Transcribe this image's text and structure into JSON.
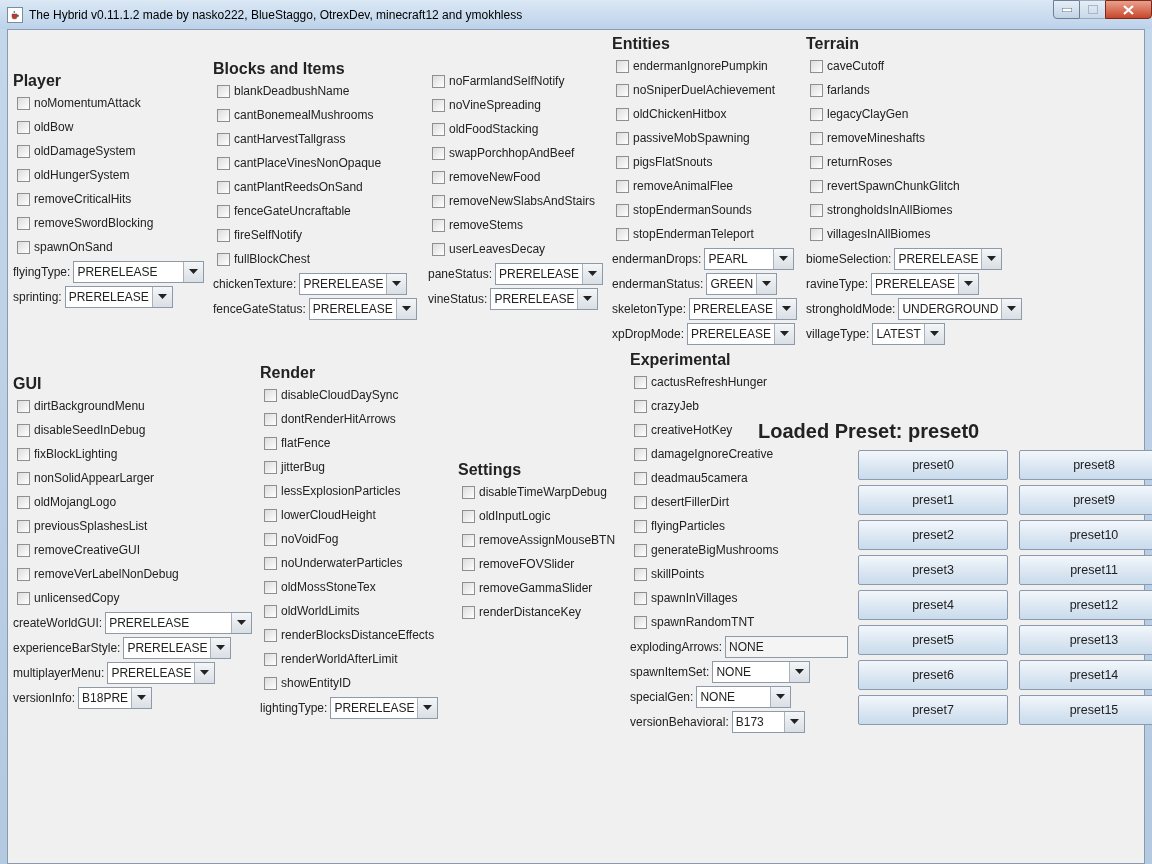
{
  "window": {
    "title": "The Hybrid v0.11.1.2 made by nasko222, BlueStaggo, OtrexDev, minecraft12 and ymokhless"
  },
  "sections": [
    {
      "title": "Player",
      "options": [
        {
          "label": "noMomentumAttack",
          "checked": false
        },
        {
          "label": "oldBow",
          "checked": false
        },
        {
          "label": "oldDamageSystem",
          "checked": false
        },
        {
          "label": "oldHungerSystem",
          "checked": false
        },
        {
          "label": "removeCriticalHits",
          "checked": false
        },
        {
          "label": "removeSwordBlocking",
          "checked": false
        },
        {
          "label": "spawnOnSand",
          "checked": false
        }
      ],
      "settings": [
        {
          "label": "flyingType:",
          "value": "PRERELEASE",
          "kind": "combo"
        },
        {
          "label": "sprinting:",
          "value": "PRERELEASE",
          "kind": "combo"
        }
      ]
    },
    {
      "title": "Blocks and Items",
      "options": [
        {
          "label": "blankDeadbushName",
          "checked": false
        },
        {
          "label": "cantBonemealMushrooms",
          "checked": false
        },
        {
          "label": "cantHarvestTallgrass",
          "checked": false
        },
        {
          "label": "cantPlaceVinesNonOpaque",
          "checked": false
        },
        {
          "label": "cantPlantReedsOnSand",
          "checked": false
        },
        {
          "label": "fenceGateUncraftable",
          "checked": false
        },
        {
          "label": "fireSelfNotify",
          "checked": false
        },
        {
          "label": "fullBlockChest",
          "checked": false
        }
      ],
      "settings": [
        {
          "label": "chickenTexture:",
          "value": "PRERELEASE",
          "kind": "combo"
        },
        {
          "label": "fenceGateStatus:",
          "value": "PRERELEASE",
          "kind": "combo"
        }
      ]
    },
    {
      "options": [
        {
          "label": "noFarmlandSelfNotify",
          "checked": false
        },
        {
          "label": "noVineSpreading",
          "checked": false
        },
        {
          "label": "oldFoodStacking",
          "checked": false
        },
        {
          "label": "swapPorchhopAndBeef",
          "checked": false
        },
        {
          "label": "removeNewFood",
          "checked": false
        },
        {
          "label": "removeNewSlabsAndStairs",
          "checked": false
        },
        {
          "label": "removeStems",
          "checked": false
        },
        {
          "label": "userLeavesDecay",
          "checked": false
        }
      ],
      "settings": [
        {
          "label": "paneStatus:",
          "value": "PRERELEASE",
          "kind": "combo"
        },
        {
          "label": "vineStatus:",
          "value": "PRERELEASE",
          "kind": "combo"
        }
      ]
    },
    {
      "title": "Entities",
      "options": [
        {
          "label": "endermanIgnorePumpkin",
          "checked": false
        },
        {
          "label": "noSniperDuelAchievement",
          "checked": false
        },
        {
          "label": "oldChickenHitbox",
          "checked": false
        },
        {
          "label": "passiveMobSpawning",
          "checked": false
        },
        {
          "label": "pigsFlatSnouts",
          "checked": false
        },
        {
          "label": "removeAnimalFlee",
          "checked": false
        },
        {
          "label": "stopEndermanSounds",
          "checked": false
        },
        {
          "label": "stopEndermanTeleport",
          "checked": false
        }
      ],
      "settings": [
        {
          "label": "endermanDrops:",
          "value": "PEARL",
          "kind": "combo"
        },
        {
          "label": "endermanStatus:",
          "value": "GREEN",
          "kind": "combo"
        },
        {
          "label": "skeletonType:",
          "value": "PRERELEASE",
          "kind": "combo"
        },
        {
          "label": "xpDropMode:",
          "value": "PRERELEASE",
          "kind": "combo"
        }
      ]
    },
    {
      "title": "Terrain",
      "options": [
        {
          "label": "caveCutoff",
          "checked": false
        },
        {
          "label": "farlands",
          "checked": false
        },
        {
          "label": "legacyClayGen",
          "checked": false
        },
        {
          "label": "removeMineshafts",
          "checked": false
        },
        {
          "label": "returnRoses",
          "checked": false
        },
        {
          "label": "revertSpawnChunkGlitch",
          "checked": false
        },
        {
          "label": "strongholdsInAllBiomes",
          "checked": false
        },
        {
          "label": "villagesInAllBiomes",
          "checked": false
        }
      ],
      "settings": [
        {
          "label": "biomeSelection:",
          "value": "PRERELEASE",
          "kind": "combo"
        },
        {
          "label": "ravineType:",
          "value": "PRERELEASE",
          "kind": "combo"
        },
        {
          "label": "strongholdMode:",
          "value": "UNDERGROUND",
          "kind": "combo"
        },
        {
          "label": "villageType:",
          "value": "LATEST",
          "kind": "combo"
        }
      ]
    },
    {
      "title": "GUI",
      "options": [
        {
          "label": "dirtBackgroundMenu",
          "checked": false
        },
        {
          "label": "disableSeedInDebug",
          "checked": false
        },
        {
          "label": "fixBlockLighting",
          "checked": false
        },
        {
          "label": "nonSolidAppearLarger",
          "checked": false
        },
        {
          "label": "oldMojangLogo",
          "checked": false
        },
        {
          "label": "previousSplashesList",
          "checked": false
        },
        {
          "label": "removeCreativeGUI",
          "checked": false
        },
        {
          "label": "removeVerLabelNonDebug",
          "checked": false
        },
        {
          "label": "unlicensedCopy",
          "checked": false
        }
      ],
      "settings": [
        {
          "label": "createWorldGUI:",
          "value": "PRERELEASE",
          "kind": "combo"
        },
        {
          "label": "experienceBarStyle:",
          "value": "PRERELEASE",
          "kind": "combo"
        },
        {
          "label": "multiplayerMenu:",
          "value": "PRERELEASE",
          "kind": "combo"
        },
        {
          "label": "versionInfo:",
          "value": "B18PRE",
          "kind": "combo"
        }
      ]
    },
    {
      "title": "Render",
      "options": [
        {
          "label": "disableCloudDaySync",
          "checked": false
        },
        {
          "label": "dontRenderHitArrows",
          "checked": false
        },
        {
          "label": "flatFence",
          "checked": false
        },
        {
          "label": "jitterBug",
          "checked": false
        },
        {
          "label": "lessExplosionParticles",
          "checked": false
        },
        {
          "label": "lowerCloudHeight",
          "checked": false
        },
        {
          "label": "noVoidFog",
          "checked": false
        },
        {
          "label": "noUnderwaterParticles",
          "checked": false
        },
        {
          "label": "oldMossStoneTex",
          "checked": false
        },
        {
          "label": "oldWorldLimits",
          "checked": false
        },
        {
          "label": "renderBlocksDistanceEffects",
          "checked": false
        },
        {
          "label": "renderWorldAfterLimit",
          "checked": false
        },
        {
          "label": "showEntityID",
          "checked": false
        }
      ],
      "settings": [
        {
          "label": "lightingType:",
          "value": "PRERELEASE",
          "kind": "combo"
        }
      ]
    },
    {
      "title": "Settings",
      "options": [
        {
          "label": "disableTimeWarpDebug",
          "checked": false
        },
        {
          "label": "oldInputLogic",
          "checked": false
        },
        {
          "label": "removeAssignMouseBTN",
          "checked": false
        },
        {
          "label": "removeFOVSlider",
          "checked": false
        },
        {
          "label": "removeGammaSlider",
          "checked": false
        },
        {
          "label": "renderDistanceKey",
          "checked": false
        }
      ]
    },
    {
      "title": "Experimental",
      "options": [
        {
          "label": "cactusRefreshHunger",
          "checked": false
        },
        {
          "label": "crazyJeb",
          "checked": false
        },
        {
          "label": "creativeHotKey",
          "checked": false
        },
        {
          "label": "damageIgnoreCreative",
          "checked": false
        },
        {
          "label": "deadmau5camera",
          "checked": false
        },
        {
          "label": "desertFillerDirt",
          "checked": false
        },
        {
          "label": "flyingParticles",
          "checked": false
        },
        {
          "label": "generateBigMushrooms",
          "checked": false
        },
        {
          "label": "skillPoints",
          "checked": false
        },
        {
          "label": "spawnInVillages",
          "checked": false
        },
        {
          "label": "spawnRandomTNT",
          "checked": false
        }
      ],
      "settings": [
        {
          "label": "explodingArrows:",
          "value": "NONE",
          "kind": "text"
        },
        {
          "label": "spawnItemSet:",
          "value": "NONE",
          "kind": "combo"
        },
        {
          "label": "specialGen:",
          "value": "NONE",
          "kind": "combo"
        },
        {
          "label": "versionBehavioral:",
          "value": "B173",
          "kind": "combo"
        }
      ]
    }
  ],
  "presets": {
    "heading": "Loaded Preset: preset0",
    "columns": [
      [
        "preset0",
        "preset1",
        "preset2",
        "preset3",
        "preset4",
        "preset5",
        "preset6",
        "preset7"
      ],
      [
        "preset8",
        "preset9",
        "preset10",
        "preset11",
        "preset12",
        "preset13",
        "preset14",
        "preset15"
      ]
    ]
  }
}
